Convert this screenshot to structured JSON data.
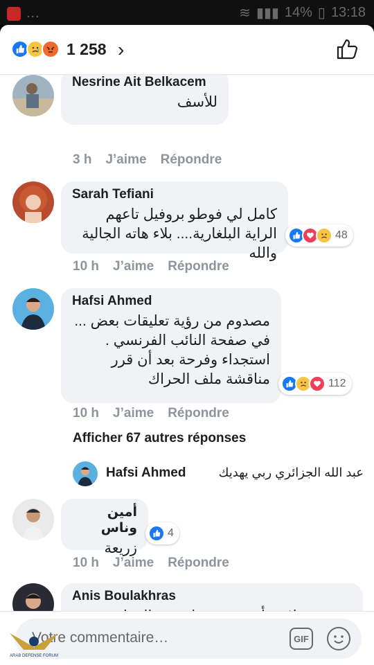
{
  "status_bar": {
    "battery": "14%",
    "time": "13:18",
    "dots": "..."
  },
  "header": {
    "reaction_count": "1 258",
    "chevron": "›"
  },
  "comments": [
    {
      "name": "Nesrine Ait Belkacem",
      "text": "للأسف",
      "time": "3 h",
      "like": "J’aime",
      "reply": "Répondre"
    },
    {
      "name": "Sarah Tefiani",
      "text": "كامل لي فوطو بروفيل تاعهم الراية البلغارية.... بلاء هاته الجالية والله",
      "time": "10 h",
      "like": "J’aime",
      "reply": "Répondre",
      "reactions": "48"
    },
    {
      "name": "Hafsi Ahmed",
      "text": "مصدوم من رؤية تعليقات بعض ... في صفحة النائب الفرنسي . استجداء وفرحة بعد أن قرر مناقشة ملف الحراك",
      "time": "10 h",
      "like": "J’aime",
      "reply": "Répondre",
      "reactions": "112"
    },
    {
      "name": "أمين وناس",
      "text": "زريعة",
      "time": "10 h",
      "like": "J’aime",
      "reply": "Répondre",
      "reactions": "4"
    },
    {
      "name": "Anis Boulakhras",
      "text": "بسبب هؤلاء سأنتخب حتى لو بقي المفلس"
    }
  ],
  "more_replies": "Afficher 67 autres réponses",
  "reply_preview": {
    "name": "Hafsi Ahmed",
    "text": "عبد الله الجزائري ربي يهديك"
  },
  "composer": {
    "placeholder": "Votre commentaire…",
    "gif": "GIF"
  },
  "watermark": {
    "text": "ARAB DEFENSE FORUM"
  },
  "colors": {
    "like": "#1877f2",
    "love": "#f33e58",
    "sad": "#f7c445",
    "angry": "#ee6b2f",
    "meta": "#8d949e",
    "bubble": "#f0f2f5"
  }
}
